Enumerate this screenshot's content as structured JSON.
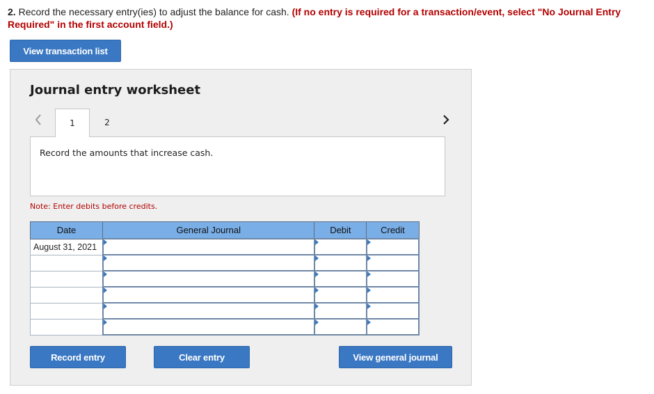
{
  "instruction": {
    "number": "2.",
    "text": " Record the necessary entry(ies) to adjust the balance for cash. ",
    "emphasis": "(If no entry is required for a transaction/event, select \"No Journal Entry Required\" in the first account field.)"
  },
  "buttons": {
    "view_transaction_list": "View transaction list",
    "record_entry": "Record entry",
    "clear_entry": "Clear entry",
    "view_general_journal": "View general journal"
  },
  "worksheet": {
    "title": "Journal entry worksheet",
    "tabs": [
      {
        "label": "1",
        "active": true
      },
      {
        "label": "2",
        "active": false
      }
    ],
    "prompt": "Record the amounts that increase cash.",
    "note": "Note: Enter debits before credits.",
    "table": {
      "headers": [
        "Date",
        "General Journal",
        "Debit",
        "Credit"
      ],
      "rows": [
        {
          "date": "August 31, 2021",
          "account": "",
          "debit": "",
          "credit": ""
        },
        {
          "date": "",
          "account": "",
          "debit": "",
          "credit": ""
        },
        {
          "date": "",
          "account": "",
          "debit": "",
          "credit": ""
        },
        {
          "date": "",
          "account": "",
          "debit": "",
          "credit": ""
        },
        {
          "date": "",
          "account": "",
          "debit": "",
          "credit": ""
        },
        {
          "date": "",
          "account": "",
          "debit": "",
          "credit": ""
        }
      ]
    }
  },
  "colors": {
    "accent": "#3a78c3",
    "table_header": "#7aaee6",
    "emphasis_red": "#b30000",
    "panel_bg": "#efefef"
  },
  "icons": {
    "prev": "chevron-left-icon",
    "next": "chevron-right-icon"
  }
}
